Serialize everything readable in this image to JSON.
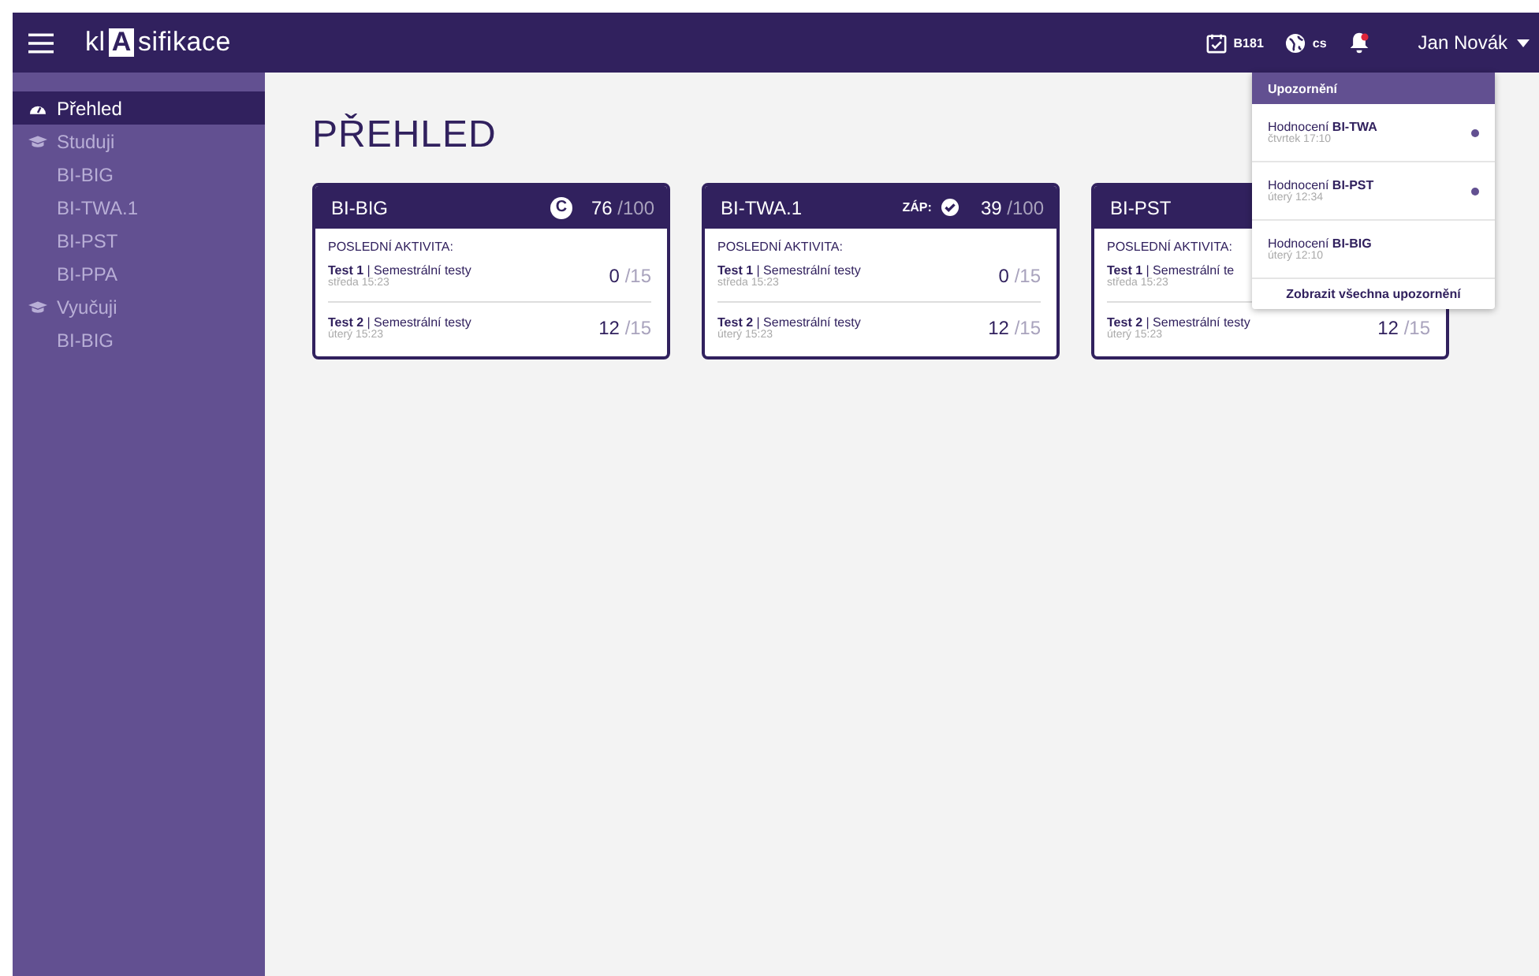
{
  "topbar": {
    "logo_pre": "kl",
    "logo_box": "A",
    "logo_post": "sifikace",
    "semester": "B181",
    "language": "cs",
    "notifications_unread": true,
    "user": "Jan Novák"
  },
  "sidebar": {
    "items": [
      {
        "kind": "section",
        "label": "Přehled",
        "selected": true
      },
      {
        "kind": "section",
        "label": "Studuji",
        "selected": false
      },
      {
        "kind": "link",
        "label": "BI-BIG",
        "selected": false
      },
      {
        "kind": "link",
        "label": "BI-TWA.1",
        "selected": false
      },
      {
        "kind": "link",
        "label": "BI-PST",
        "selected": false
      },
      {
        "kind": "link",
        "label": "BI-PPA",
        "selected": false
      },
      {
        "kind": "section",
        "label": "Vyučuji",
        "selected": false
      },
      {
        "kind": "link",
        "label": "BI-BIG",
        "selected": false
      }
    ]
  },
  "page_title": "PŘEHLED",
  "cards": [
    {
      "course": "BI-BIG",
      "badge": {
        "kind": "grade",
        "text": "C"
      },
      "score": "76",
      "max": "/100",
      "activity_label": "POSLEDNÍ AKTIVITA:",
      "activities": [
        {
          "title": "**Test 1** | Semestrální testy",
          "date": "středa 15:23",
          "score": "0",
          "max": "/15"
        },
        {
          "title": "**Test 2** | Semestrální testy",
          "date": "úterý 15:23",
          "score": "12",
          "max": "/15"
        }
      ]
    },
    {
      "course": "BI-TWA.1",
      "badge": {
        "kind": "credit",
        "text": "ZÁP:"
      },
      "score": "39",
      "max": "/100",
      "activity_label": "POSLEDNÍ AKTIVITA:",
      "activities": [
        {
          "title": "**Test 1** | Semestrální testy",
          "date": "středa 15:23",
          "score": "0",
          "max": "/15"
        },
        {
          "title": "**Test 2** | Semestrální testy",
          "date": "úterý 15:23",
          "score": "12",
          "max": "/15"
        }
      ]
    },
    {
      "course": "BI-PST",
      "activity_label": "POSLEDNÍ AKTIVITA:",
      "activities": [
        {
          "title": "**Test 1** | Semestrální te",
          "date": "středa 15:23"
        },
        {
          "title": "**Test 2** | Semestrální testy",
          "date": "úterý 15:23",
          "score": "12",
          "max": "/15"
        }
      ]
    }
  ],
  "notifications": {
    "title": "Upozornění",
    "items": [
      {
        "text": "Hodnocení **BI-TWA**",
        "date": "čtvrtek 17:10",
        "unread": true
      },
      {
        "text": "Hodnocení **BI-PST**",
        "date": "úterý 12:34",
        "unread": true
      },
      {
        "text": "Hodnocení **BI-BIG**",
        "date": "úterý 12:10",
        "unread": false
      }
    ],
    "show_all": "Zobrazit všechna upozornění"
  }
}
